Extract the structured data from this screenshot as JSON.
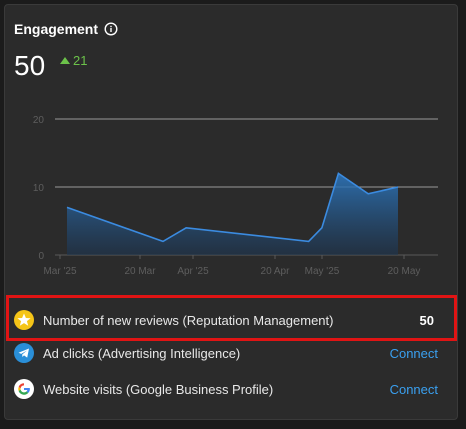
{
  "widget": {
    "title": "Engagement",
    "info_icon": "info-icon",
    "value": "50",
    "delta": "21",
    "delta_icon": "triangle-up-icon",
    "delta_color": "#6cc24a"
  },
  "chart_data": {
    "type": "area",
    "x": [
      "Mar '25",
      "20 Mar",
      "Apr '25",
      "20 Apr",
      "May '25",
      "20 May"
    ],
    "y_ticks": [
      0,
      10,
      20
    ],
    "ylim": [
      0,
      20
    ],
    "series": [
      {
        "values": [
          7,
          2,
          4,
          2,
          4,
          12,
          9,
          10
        ]
      }
    ],
    "point_positions": [
      0.0,
      0.29,
      0.36,
      0.73,
      0.77,
      0.82,
      0.91,
      1.0
    ],
    "color": "#2d7ac4",
    "grid": true
  },
  "metrics": [
    {
      "icon": "star-icon",
      "label": "Number of new reviews (Reputation Management)",
      "value": "50",
      "highlighted": true
    },
    {
      "icon": "telegram-icon",
      "label": "Ad clicks (Advertising Intelligence)",
      "action": "Connect"
    },
    {
      "icon": "google-icon",
      "label": "Website visits (Google Business Profile)",
      "action": "Connect"
    }
  ]
}
